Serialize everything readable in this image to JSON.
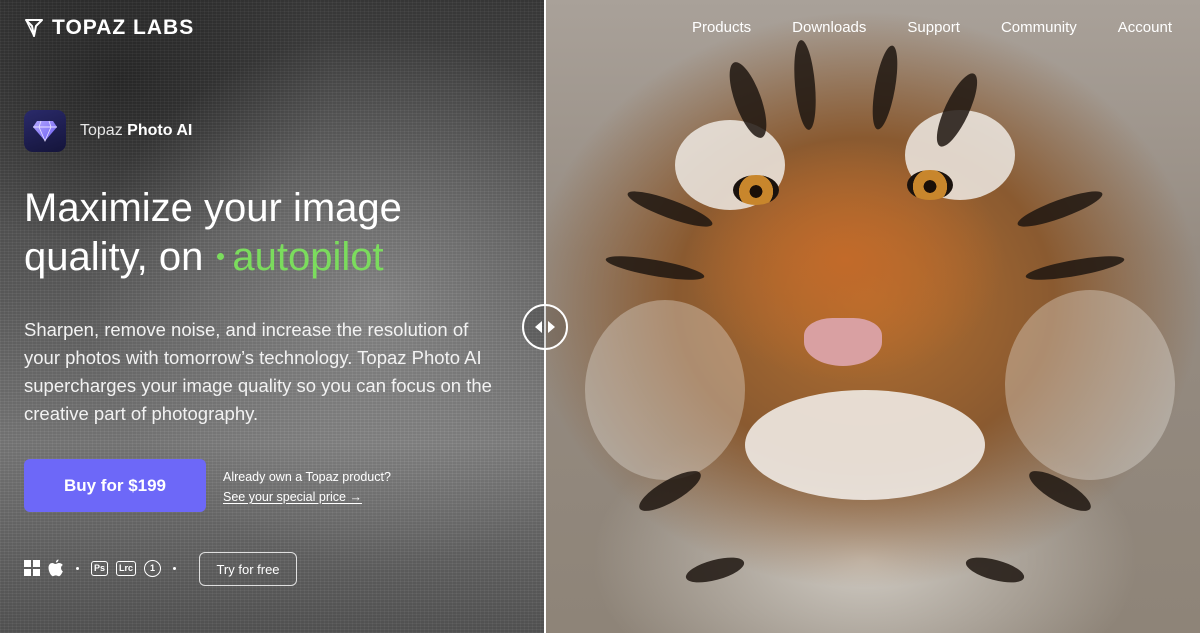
{
  "brand": {
    "name": "TOPAZ LABS"
  },
  "nav": {
    "items": [
      {
        "label": "Products"
      },
      {
        "label": "Downloads"
      },
      {
        "label": "Support"
      },
      {
        "label": "Community"
      },
      {
        "label": "Account"
      }
    ]
  },
  "product": {
    "prefix": "Topaz",
    "name": "Photo AI"
  },
  "hero": {
    "headline_part1": "Maximize your image quality, on",
    "headline_accent": "autopilot",
    "description": "Sharpen, remove noise, and increase the resolution of your photos with tomorrow’s technology. Topaz Photo AI supercharges your image quality so you can focus on the creative part of photography."
  },
  "cta": {
    "buy_label": "Buy for $199",
    "owner_question": "Already own a Topaz product?",
    "owner_link": "See your special price →",
    "try_label": "Try for free"
  },
  "platforms": {
    "icons": [
      "windows-icon",
      "apple-icon",
      "photoshop-icon",
      "lightroom-classic-icon",
      "one-icon"
    ],
    "ps_badge": "Ps",
    "lrc_badge": "Lrc",
    "one_badge": "1"
  },
  "colors": {
    "accent_green": "#7bdc5d",
    "buy_button": "#6d68f8"
  }
}
